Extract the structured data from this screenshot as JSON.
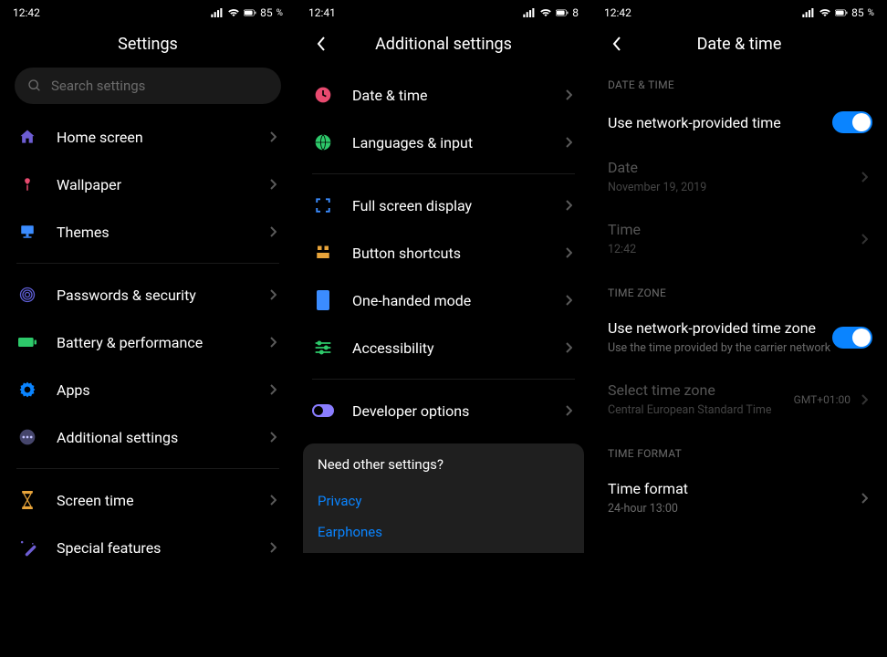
{
  "status": {
    "time1": "12:42",
    "time2": "12:41",
    "time3": "12:42",
    "battery": "85"
  },
  "s1": {
    "title": "Settings",
    "search_ph": "Search settings",
    "items": {
      "home": "Home screen",
      "wall": "Wallpaper",
      "themes": "Themes",
      "sec": "Passwords & security",
      "batt": "Battery & performance",
      "apps": "Apps",
      "add": "Additional settings",
      "stime": "Screen time",
      "special": "Special features"
    }
  },
  "s2": {
    "title": "Additional settings",
    "items": {
      "dt": "Date & time",
      "lang": "Languages & input",
      "full": "Full screen display",
      "btn": "Button shortcuts",
      "one": "One-handed mode",
      "acc": "Accessibility",
      "dev": "Developer options"
    },
    "need": "Need other settings?",
    "privacy": "Privacy",
    "ear": "Earphones"
  },
  "s3": {
    "title": "Date & time",
    "sec_dt": "DATE & TIME",
    "net_time": "Use network-provided time",
    "date_l": "Date",
    "date_v": "November 19, 2019",
    "time_l": "Time",
    "time_v": "12:42",
    "sec_tz": "TIME ZONE",
    "net_tz": "Use network-provided time zone",
    "net_tz_sub": "Use the time provided by the carrier network",
    "sel_tz": "Select time zone",
    "sel_tz_sub": "Central European Standard Time",
    "sel_tz_val": "GMT+01:00",
    "sec_tf": "TIME FORMAT",
    "tf": "Time format",
    "tf_sub": "24-hour 13:00"
  }
}
